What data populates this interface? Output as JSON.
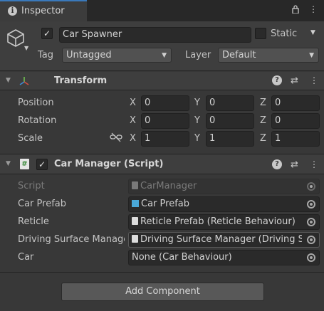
{
  "tab": {
    "title": "Inspector"
  },
  "gameobject": {
    "name": "Car Spawner",
    "static_label": "Static",
    "tag_label": "Tag",
    "tag_value": "Untagged",
    "layer_label": "Layer",
    "layer_value": "Default"
  },
  "transform": {
    "title": "Transform",
    "rows": [
      {
        "label": "Position",
        "x": "0",
        "y": "0",
        "z": "0"
      },
      {
        "label": "Rotation",
        "x": "0",
        "y": "0",
        "z": "0"
      },
      {
        "label": "Scale",
        "x": "1",
        "y": "1",
        "z": "1"
      }
    ],
    "axis_x": "X",
    "axis_y": "Y",
    "axis_z": "Z"
  },
  "car_manager": {
    "title": "Car Manager (Script)",
    "fields": [
      {
        "label": "Script",
        "value": "CarManager"
      },
      {
        "label": "Car Prefab",
        "value": "Car Prefab"
      },
      {
        "label": "Reticle",
        "value": "Reticle Prefab (Reticle Behaviour)"
      },
      {
        "label": "Driving Surface Manager",
        "value": "Driving Surface Manager (Driving Surface Manager)"
      },
      {
        "label": "Car",
        "value": "None (Car Behaviour)"
      }
    ]
  },
  "add_component": {
    "label": "Add Component"
  }
}
